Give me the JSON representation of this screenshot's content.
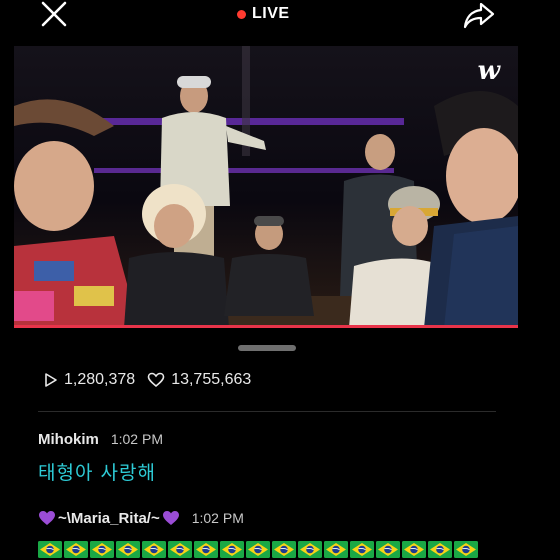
{
  "header": {
    "live_label": "LIVE",
    "close_icon": "close-icon",
    "share_icon": "share-icon",
    "live_dot_color": "#ff3b30"
  },
  "video": {
    "watermark": "w",
    "progress_color": "#e8344a"
  },
  "stats": {
    "plays": "1,280,378",
    "likes": "13,755,663",
    "play_icon": "play-icon",
    "heart_icon": "heart-outline-icon"
  },
  "comments": [
    {
      "author": "Mihokim",
      "time": "1:02 PM",
      "text": "태형아 사랑해"
    },
    {
      "author": "~\\Maria_Rita/~",
      "author_icon": "purple-heart-icon",
      "time": "1:02 PM",
      "text_icon": "brazil-flag-icon",
      "flag_count": 17
    }
  ],
  "colors": {
    "accent_comment": "#2ecbd6",
    "heart_purple": "#9b4dd6"
  }
}
